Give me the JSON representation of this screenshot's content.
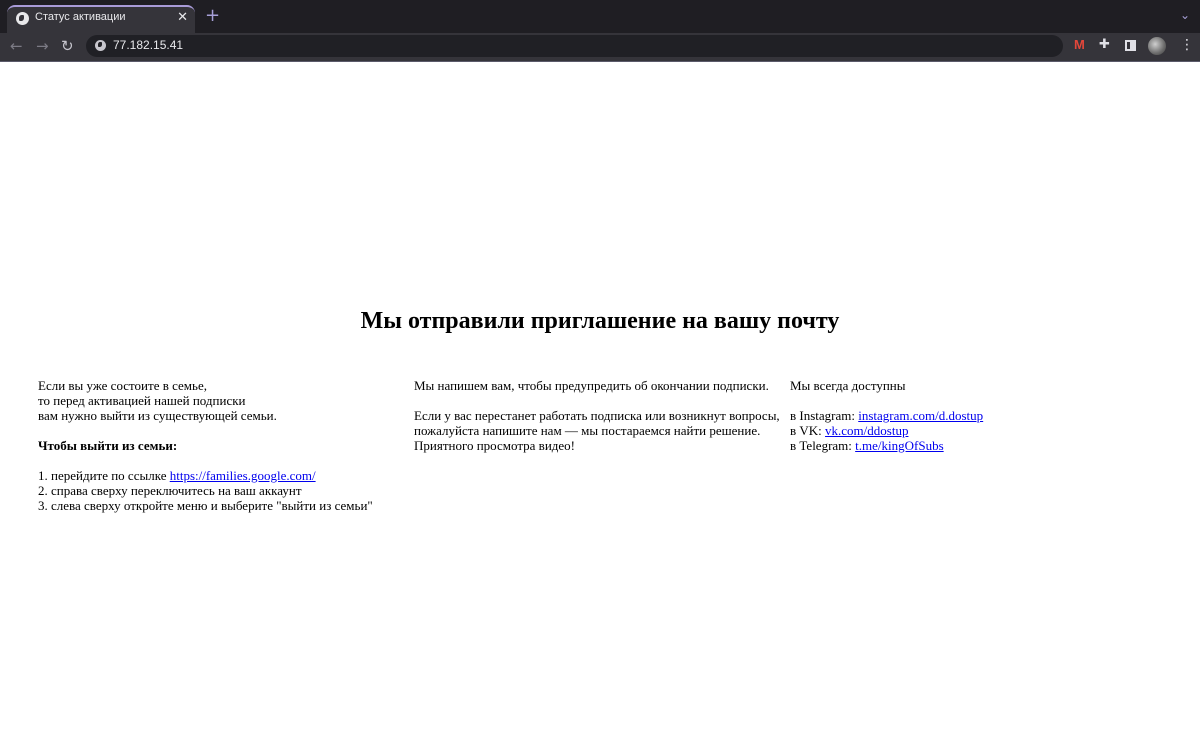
{
  "browser": {
    "tab_title": "Статус активации",
    "tab_close": "✕",
    "new_tab": "+",
    "tab_dropdown": "⌄",
    "url": "77.182.15.41",
    "nav_back": "←",
    "nav_forward": "→",
    "nav_reload": "↻",
    "extensions_icon": "puzzle-icon",
    "menu_glyph": "⋮",
    "gmail_glyph": "M",
    "puzzle_glyph": "✚",
    "colors": {
      "tab_strip": "#1f1e23",
      "toolbar": "#35343a",
      "accent": "#a99bd8"
    }
  },
  "page": {
    "heading": "Мы отправили приглашение на вашу почту",
    "left": {
      "line1": "Если вы уже состоите в семье,",
      "line2": "то перед активацией нашей подписки",
      "line3": "вам нужно выйти из существующей семьи.",
      "exit_title": "Чтобы выйти из семьи:",
      "step1_prefix": "1. перейдите по ссылке ",
      "step1_link": "https://families.google.com/",
      "step2": "2. справа сверху переключитесь на ваш аккаунт",
      "step3": "3. слева сверху откройте меню и выберите \"выйти из семьи\""
    },
    "middle": {
      "line1": "Мы напишем вам, чтобы предупредить об окончании подписки.",
      "line2": "Если у вас перестанет работать подписка или возникнут вопросы,",
      "line3": "пожалуйста напишите нам — мы постараемся найти решение.",
      "line4": "Приятного просмотра видео!"
    },
    "right": {
      "line1": "Мы всегда доступны",
      "instagram_prefix": "в Instagram: ",
      "instagram_link": "instagram.com/d.dostup",
      "vk_prefix": "в VK: ",
      "vk_link": "vk.com/ddostup",
      "telegram_prefix": "в Telegram: ",
      "telegram_link": "t.me/kingOfSubs"
    },
    "colors": {
      "link": "#0000ee"
    }
  }
}
